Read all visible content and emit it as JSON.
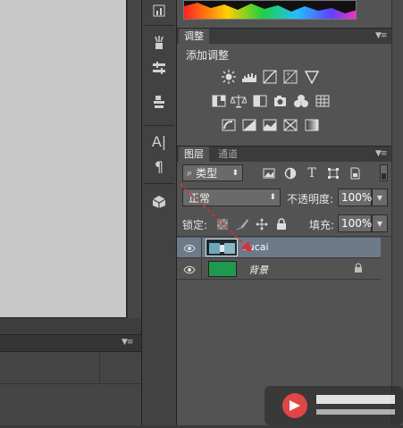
{
  "adjustments_panel": {
    "tab_label": "调整",
    "title": "添加调整",
    "menu_icon": "panel-menu-icon",
    "row1": [
      "brightness-contrast-icon",
      "levels-icon",
      "curves-icon",
      "exposure-icon",
      "vibrance-icon"
    ],
    "row2": [
      "hue-saturation-icon",
      "color-balance-icon",
      "black-white-icon",
      "photo-filter-icon",
      "channel-mixer-icon",
      "color-lookup-icon"
    ],
    "row3": [
      "invert-icon",
      "posterize-icon",
      "threshold-icon",
      "selective-color-icon",
      "gradient-map-icon"
    ]
  },
  "layers_panel": {
    "tab_layers": "图层",
    "tab_channels": "通道",
    "filter_kind": "类型",
    "blend_mode": "正常",
    "opacity_label": "不透明度:",
    "opacity_value": "100%",
    "lock_label": "锁定:",
    "fill_label": "填充:",
    "fill_value": "100%",
    "layers": [
      {
        "name": "sucai",
        "selected": true,
        "visible": true,
        "locked": false
      },
      {
        "name": "背景",
        "selected": false,
        "visible": true,
        "locked": true
      }
    ]
  },
  "colors": {
    "background_layer_thumb": "#1e9a50",
    "selected_row": "#6d7a8a",
    "arrow": "#d93030"
  }
}
